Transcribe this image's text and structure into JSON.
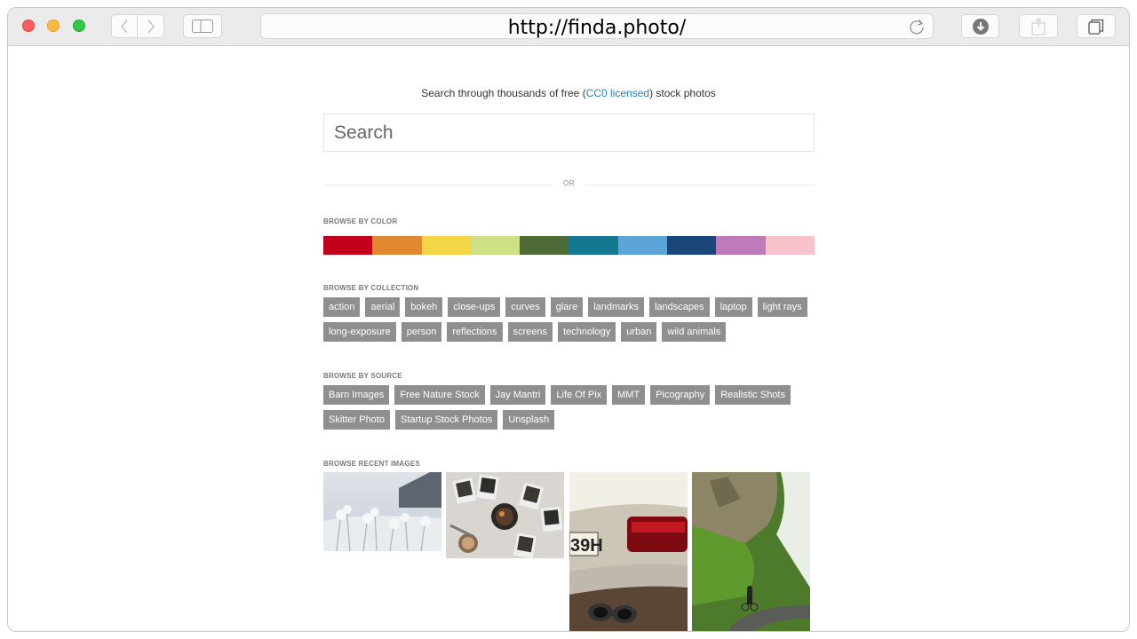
{
  "browser": {
    "url": "http://finda.photo/"
  },
  "page": {
    "tagline_before": "Search through thousands of free (",
    "tagline_link": "CC0 licensed",
    "tagline_after": ") stock photos",
    "search_placeholder": "Search",
    "or_label": "OR",
    "color_label": "BROWSE BY COLOR",
    "colors": [
      "#c3001b",
      "#e0872f",
      "#f3d545",
      "#cde184",
      "#4f6b35",
      "#147890",
      "#5da5d8",
      "#1a467a",
      "#be7bbb",
      "#f9c1cc"
    ],
    "collection_label": "BROWSE BY COLLECTION",
    "collections": [
      "action",
      "aerial",
      "bokeh",
      "close-ups",
      "curves",
      "glare",
      "landmarks",
      "landscapes",
      "laptop",
      "light rays",
      "long-exposure",
      "person",
      "reflections",
      "screens",
      "technology",
      "urban",
      "wild animals"
    ],
    "source_label": "BROWSE BY SOURCE",
    "sources": [
      "Barn Images",
      "Free Nature Stock",
      "Jay Mantri",
      "Life Of Pix",
      "MMT",
      "Picography",
      "Realistic Shots",
      "Skitter Photo",
      "Startup Stock Photos",
      "Unsplash"
    ],
    "recent_label": "BROWSE RECENT IMAGES"
  }
}
